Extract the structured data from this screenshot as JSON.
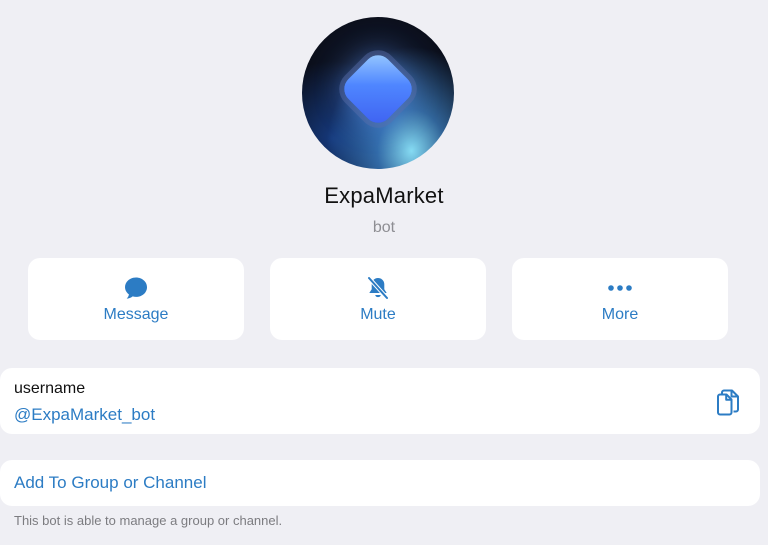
{
  "profile": {
    "name": "ExpaMarket",
    "subtitle": "bot"
  },
  "actions": {
    "message": {
      "label": "Message",
      "icon": "chat-bubble-icon"
    },
    "mute": {
      "label": "Mute",
      "icon": "bell-slash-icon"
    },
    "more": {
      "label": "More",
      "icon": "ellipsis-icon"
    }
  },
  "info": {
    "username_label": "username",
    "username_value": "@ExpaMarket_bot",
    "copy_icon": "copy-icon"
  },
  "group": {
    "add_label": "Add To Group or Channel",
    "note": "This bot is able to manage a group or channel."
  },
  "colors": {
    "accent": "#2c7cc4",
    "background": "#efeff4",
    "card": "#ffffff"
  }
}
